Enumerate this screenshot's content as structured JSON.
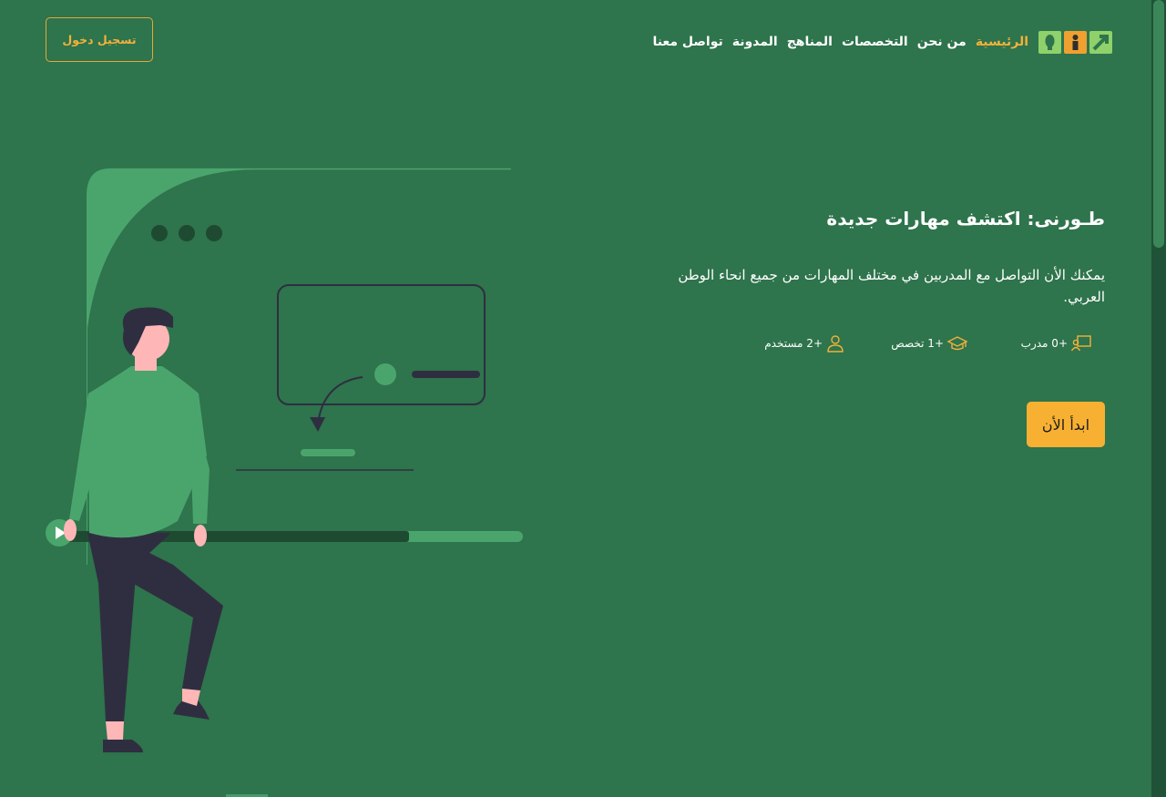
{
  "header": {
    "login_label": "تسجيل دخول",
    "nav": [
      {
        "label": "الرئيسية",
        "active": true
      },
      {
        "label": "من نحن",
        "active": false
      },
      {
        "label": "التخصصات",
        "active": false
      },
      {
        "label": "المناهج",
        "active": false
      },
      {
        "label": "المدونة",
        "active": false
      },
      {
        "label": "تواصل معنا",
        "active": false
      }
    ],
    "logo_colors": [
      "#8fd16a",
      "#f0a030",
      "#8fd16a"
    ]
  },
  "hero": {
    "title": "طـورنى: اكتشف مهارات جديدة",
    "description": "يمكنك الأن التواصل مع المدربين في مختلف المهارات من جميع انحاء الوطن العربي.",
    "stats": {
      "trainers": {
        "label": "+0 مدرب",
        "icon": "trainer-icon"
      },
      "specialties": {
        "label": "+1 تخصص",
        "icon": "graduation-cap-icon"
      },
      "users": {
        "label": "+2 مستخدم",
        "icon": "user-icon"
      }
    },
    "cta_label": "ابدأ الأن"
  },
  "colors": {
    "background": "#2e744c",
    "accent": "#f7b032",
    "illustration_green": "#4aa56d",
    "dark": "#2f2e41"
  }
}
